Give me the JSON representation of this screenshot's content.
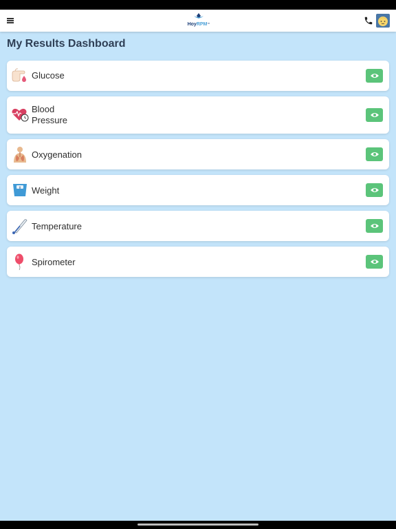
{
  "app": {
    "logo_hoy": "Hoy",
    "logo_rpm": "RPM",
    "logo_tm": "™",
    "icons": {
      "menu": "hamburger-icon",
      "phone": "phone-icon",
      "avatar": "user-avatar"
    }
  },
  "page": {
    "title": "My Results Dashboard"
  },
  "results": [
    {
      "label": "Glucose",
      "icon": "glucose-icon"
    },
    {
      "label": "Blood Pressure",
      "icon": "blood-pressure-icon"
    },
    {
      "label": "Oxygenation",
      "icon": "oxygenation-icon"
    },
    {
      "label": "Weight",
      "icon": "weight-scale-icon"
    },
    {
      "label": "Temperature",
      "icon": "thermometer-icon"
    },
    {
      "label": "Spirometer",
      "icon": "balloon-icon"
    }
  ],
  "colors": {
    "background": "#c3e4fa",
    "view_button": "#5bc47a",
    "title": "#2f3f55"
  }
}
